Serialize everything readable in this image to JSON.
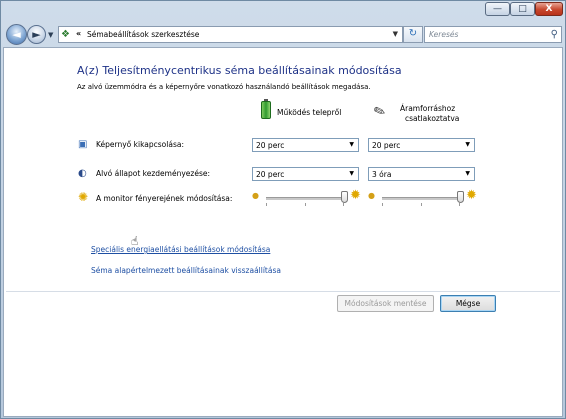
{
  "window": {
    "min_glyph": "—",
    "max_glyph": "□",
    "close_glyph": "X"
  },
  "nav": {
    "back_glyph": "◄",
    "forward_glyph": "►",
    "breadcrumb_chevron": "«",
    "address_text": "Sémabeállítások szerkesztése",
    "address_icon": "control-panel-icon",
    "refresh_glyph": "↻",
    "search_placeholder": "Keresés"
  },
  "main": {
    "title": "A(z) Teljesítménycentrikus séma beállításainak módosítása",
    "subtitle": "Az alvó üzemmódra és a képernyőre vonatkozó használandó beállítások megadása.",
    "columns": {
      "battery": "Működés telepről",
      "plugged_line1": "Áramforráshoz",
      "plugged_line2": "csatlakoztatva"
    },
    "rows": {
      "display_off_label": "Képernyő kikapcsolása:",
      "display_off_battery": "20 perc",
      "display_off_plugged": "20 perc",
      "sleep_label": "Alvó állapot kezdeményezése:",
      "sleep_battery": "20 perc",
      "sleep_plugged": "3 óra",
      "brightness_label": "A monitor fényerejének módosítása:",
      "brightness_battery": 1.0,
      "brightness_plugged": 1.0
    },
    "links": {
      "advanced": "Speciális energiaellátási beállítások módosítása",
      "restore": "Séma alapértelmezett beállításainak visszaállítása"
    },
    "buttons": {
      "save": "Módosítások mentése",
      "cancel": "Mégse"
    }
  },
  "colors": {
    "title": "#1e3287",
    "link": "#1e4fa3"
  }
}
